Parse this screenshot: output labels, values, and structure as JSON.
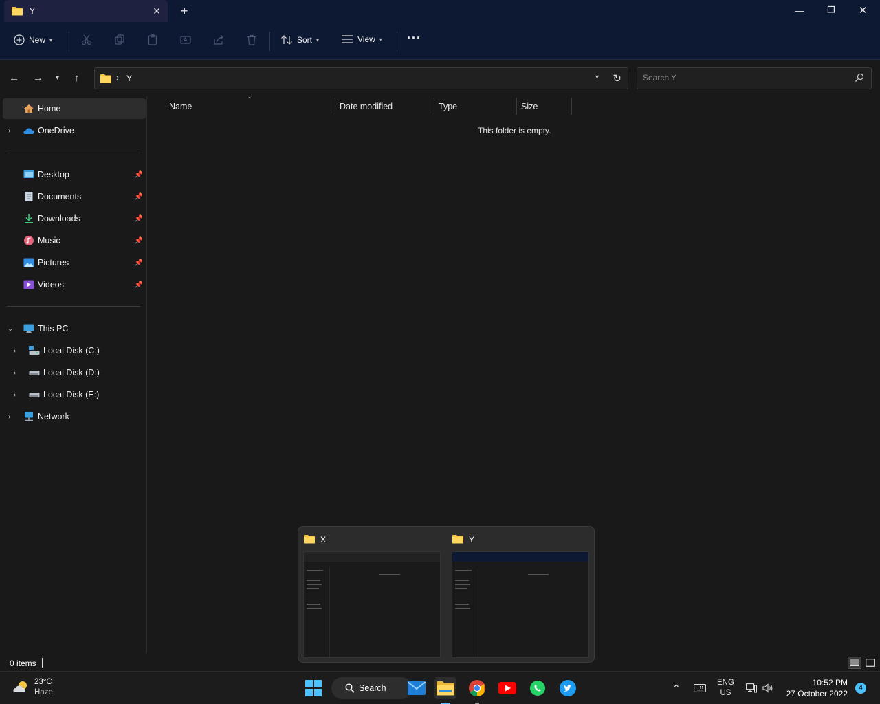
{
  "window": {
    "tab_title": "Y",
    "tab_close": "✕",
    "new_tab": "+",
    "minimize": "—",
    "maximize": "❐",
    "close": "✕"
  },
  "toolbar": {
    "new_label": "New",
    "sort_label": "Sort",
    "view_label": "View",
    "more_label": "···"
  },
  "address": {
    "separator": "›",
    "crumb": "Y"
  },
  "search": {
    "placeholder": "Search Y"
  },
  "sidebar": {
    "home": "Home",
    "onedrive": "OneDrive",
    "pinned": [
      {
        "label": "Desktop",
        "icon": "desktop-icon"
      },
      {
        "label": "Documents",
        "icon": "documents-icon"
      },
      {
        "label": "Downloads",
        "icon": "downloads-icon"
      },
      {
        "label": "Music",
        "icon": "music-icon"
      },
      {
        "label": "Pictures",
        "icon": "pictures-icon"
      },
      {
        "label": "Videos",
        "icon": "videos-icon"
      }
    ],
    "this_pc": "This PC",
    "drives": [
      "Local Disk (C:)",
      "Local Disk (D:)",
      "Local Disk (E:)"
    ],
    "network": "Network"
  },
  "columns": {
    "name": "Name",
    "date_modified": "Date modified",
    "type": "Type",
    "size": "Size"
  },
  "empty_message": "This folder is empty.",
  "status": {
    "item_count": "0 items"
  },
  "thumbnails": [
    {
      "title": "X"
    },
    {
      "title": "Y"
    }
  ],
  "taskbar": {
    "temperature": "23°C",
    "condition": "Haze",
    "search_label": "Search",
    "language": "ENG",
    "region": "US",
    "time": "10:52 PM",
    "date": "27 October 2022",
    "notification_count": "4"
  },
  "colors": {
    "accent": "#4cc2ff",
    "folder": "#f5c542",
    "titlebar": "#0d1833"
  }
}
